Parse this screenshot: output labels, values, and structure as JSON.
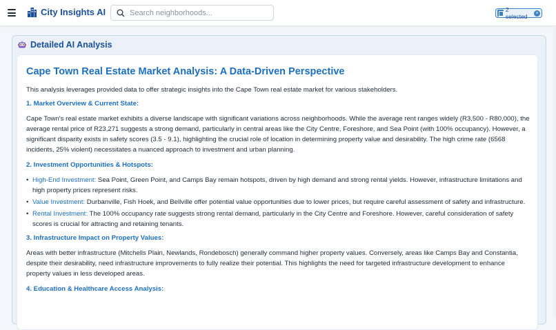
{
  "app": {
    "name": "City Insights AI",
    "search_placeholder": "Search neighborhoods...",
    "selected_label": "2 selected",
    "icons": [
      "menu-icon",
      "city-icon",
      "search-icon",
      "selection-icon",
      "close-icon",
      "robot-icon"
    ]
  },
  "section": {
    "title": "Detailed AI Analysis"
  },
  "report": {
    "title": "Cape Town Real Estate Market Analysis: A Data-Driven Perspective",
    "intro": "This analysis leverages provided data to offer strategic insights into the Cape Town real estate market for various stakeholders.",
    "s1_heading": "1. Market Overview & Current State:",
    "s1_body": "Cape Town's real estate market exhibits a diverse landscape with significant variations across neighborhoods. While the average rent ranges widely (R3,500 - R80,000), the average rental price of R23,271 suggests a strong demand, particularly in central areas like the City Centre, Foreshore, and Sea Point (with 100% occupancy). However, a significant disparity exists in safety scores (3.5 - 9.1), highlighting the crucial role of location in determining property value and desirability. The high crime rate (6568 incidents, 25% violent) necessitates a nuanced approach to investment and urban planning.",
    "s2_heading": "2. Investment Opportunities & Hotspots:",
    "s2_items": [
      {
        "term": "High-End Investment:",
        "text": " Sea Point, Green Point, and Camps Bay remain hotspots, driven by high demand and strong rental yields. However, infrastructure limitations and high property prices represent risks."
      },
      {
        "term": "Value Investment:",
        "text": " Durbanville, Fish Hoek, and Bellville offer potential value opportunities due to lower prices, but require careful assessment of safety and infrastructure."
      },
      {
        "term": "Rental Investment:",
        "text": " The 100% occupancy rate suggests strong rental demand, particularly in the City Centre and Foreshore. However, careful consideration of safety scores is crucial for attracting and retaining tenants."
      }
    ],
    "s3_heading": "3. Infrastructure Impact on Property Values:",
    "s3_body": "Areas with better infrastructure (Mitchells Plain, Newlands, Rondebosch) generally command higher property values. Conversely, areas like Camps Bay and Constantia, despite their desirability, need infrastructure improvements to fully realize their potential. This highlights the need for targeted infrastructure development to enhance property values in less developed areas.",
    "s4_heading": "4. Education & Healthcare Access Analysis:"
  },
  "colors": {
    "brand": "#1b4f9c",
    "accent": "#1c6fc0",
    "card_bg": "#eaf1f8"
  }
}
